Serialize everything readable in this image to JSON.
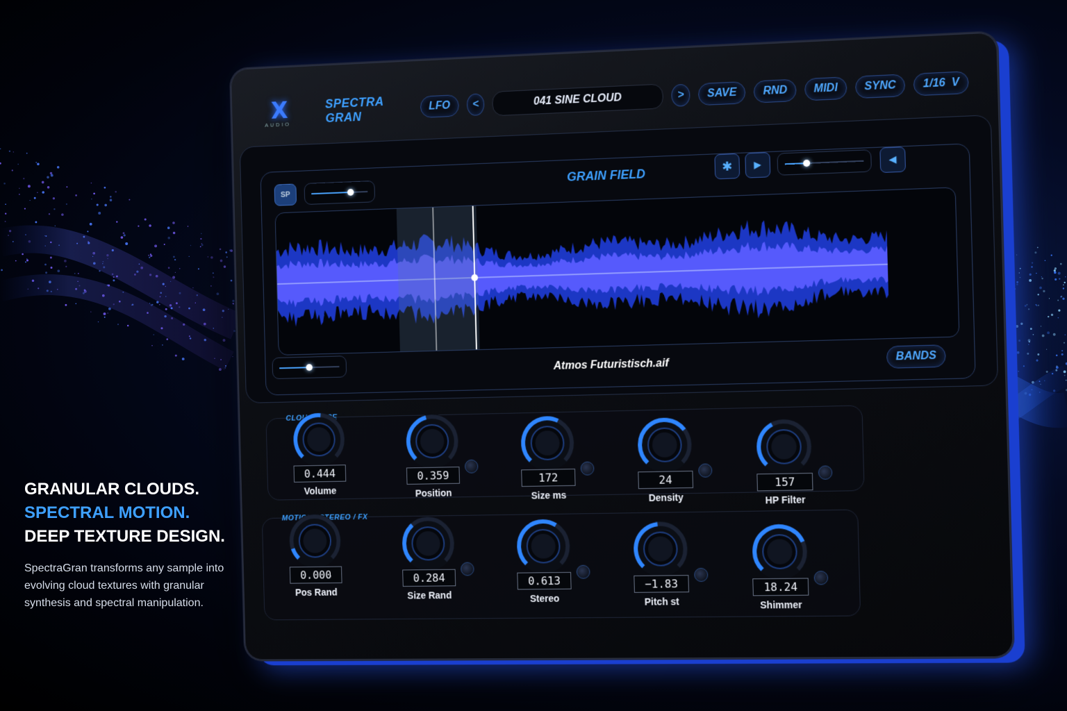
{
  "app": {
    "logo_text": "X",
    "logo_sub": "AUDIO",
    "brand": "SPECTRA GRAN",
    "lfo": "LFO",
    "prev": "<",
    "next": ">",
    "preset": "041  SINE CLOUD",
    "save": "SAVE",
    "rnd": "RND",
    "midi": "MIDI",
    "sync": "SYNC",
    "rate": "1/16",
    "rate_arrow": "V"
  },
  "grain_field": {
    "title": "GRAIN FIELD",
    "sp_label": "SP",
    "freeze_icon": "snowflake-icon",
    "play_icon": "play-icon",
    "reverse_icon": "reverse-icon",
    "filename": "Atmos Futuristisch.aif",
    "bands": "BANDS",
    "sp_slider": 0.7,
    "top_slider": 0.28,
    "zoom_slider": 0.5,
    "accent": "#3ea0ff",
    "wave_color": "#5a5cff"
  },
  "cloud_core": {
    "label": "CLOUD CORE",
    "knobs": [
      {
        "value": "0.444",
        "label": "Volume",
        "level": 0.52
      },
      {
        "value": "0.359",
        "label": "Position",
        "level": 0.45
      },
      {
        "value": "172",
        "label": "Size ms",
        "level": 0.6
      },
      {
        "value": "24",
        "label": "Density",
        "level": 0.7
      },
      {
        "value": "157",
        "label": "HP Filter",
        "level": 0.4
      }
    ]
  },
  "motion": {
    "label": "MOTION / STEREO / FX",
    "knobs": [
      {
        "value": "0.000",
        "label": "Pos Rand",
        "level": 0.1
      },
      {
        "value": "0.284",
        "label": "Size Rand",
        "level": 0.35
      },
      {
        "value": "0.613",
        "label": "Stereo",
        "level": 0.62
      },
      {
        "value": "−1.83",
        "label": "Pitch st",
        "level": 0.48
      },
      {
        "value": "18.24",
        "label": "Shimmer",
        "level": 0.75
      }
    ]
  },
  "marketing": {
    "line1": "GRANULAR CLOUDS.",
    "line2": "SPECTRAL MOTION.",
    "line3": "DEEP TEXTURE DESIGN.",
    "description": "SpectraGran transforms any sample into evolving cloud textures with granular synthesis and spectral manipulation."
  }
}
